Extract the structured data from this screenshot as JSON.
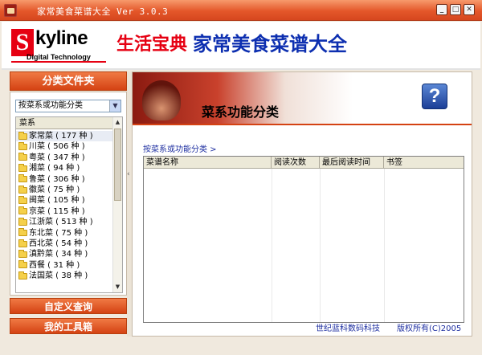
{
  "window": {
    "title": "家常美食菜谱大全 Ver 3.0.3"
  },
  "banner": {
    "logo_text": "kyline",
    "logo_letter": "S",
    "logo_sub": "Digital Technology",
    "slogan": "生活宝典",
    "app_name": "家常美食菜谱大全"
  },
  "sidebar": {
    "category_header": "分类文件夹",
    "selected_category": "按菜系或功能分类",
    "list_header": "菜系",
    "items": [
      "家常菜 ( 177 种 )",
      "川菜 ( 506 种 )",
      "粤菜 ( 347 种 )",
      "湘菜 ( 94 种 )",
      "鲁菜 ( 306 种 )",
      "徽菜 ( 75 种 )",
      "闽菜 ( 105 种 )",
      "京菜 ( 115 种 )",
      "江浙菜 ( 513 种 )",
      "东北菜 ( 75 种 )",
      "西北菜 ( 54 种 )",
      "滇黔菜 ( 34 种 )",
      "西餐 ( 31 种 )",
      "法国菜 ( 38 种 )"
    ],
    "custom_query": "自定义查询",
    "toolbox": "我的工具箱"
  },
  "content": {
    "hero_title": "菜系功能分类",
    "help_label": "?",
    "breadcrumb": "按菜系或功能分类 >",
    "columns": [
      "菜谱名称",
      "阅读次数",
      "最后阅读时间",
      "书签"
    ],
    "footer_company": "世纪蓝科数码科技",
    "footer_copyright": "版权所有(C)2005"
  }
}
